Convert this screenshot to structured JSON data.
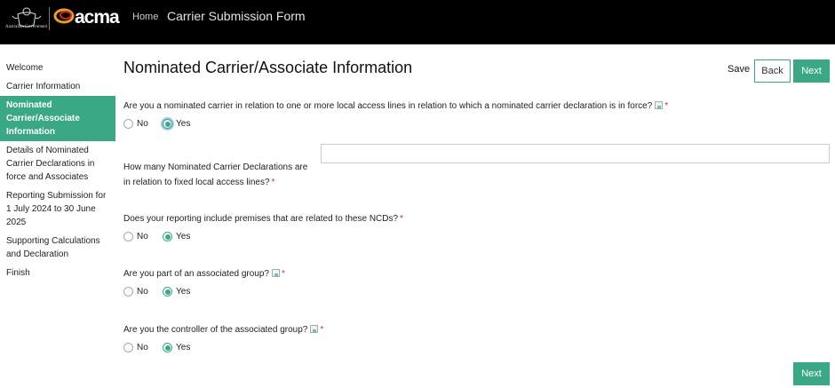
{
  "header": {
    "crest_caption": "Australian Government",
    "logo_text": "acma",
    "home_label": "Home",
    "app_title": "Carrier Submission Form"
  },
  "sidebar": {
    "items": [
      {
        "label": "Welcome"
      },
      {
        "label": "Carrier Information"
      },
      {
        "label": "Nominated Carrier/Associate Information",
        "active": true
      },
      {
        "label": "Details of Nominated Carrier Declarations in force and Associates"
      },
      {
        "label": "Reporting Submission for 1 July 2024 to 30 June 2025"
      },
      {
        "label": "Supporting Calculations and Declaration"
      },
      {
        "label": "Finish"
      }
    ]
  },
  "main": {
    "title": "Nominated Carrier/Associate Information",
    "save_label": "Save",
    "back_label": "Back",
    "next_label": "Next",
    "next_bottom_label": "Next",
    "required_marker": "*",
    "questions": [
      {
        "text": "Are you a nominated carrier in relation to one or more local access lines in relation to which a nominated carrier declaration is in force?",
        "has_help": true,
        "options": [
          "No",
          "Yes"
        ],
        "selected": "Yes"
      },
      {
        "text": "How many Nominated Carrier Declarations are in relation to fixed local access lines?",
        "has_help": false,
        "input_value": "",
        "input_placeholder": ""
      },
      {
        "text": "Does your reporting include premises that are related to these NCDs?",
        "has_help": false,
        "options": [
          "No",
          "Yes"
        ],
        "selected": "Yes"
      },
      {
        "text": "Are you part of an associated group?",
        "has_help": true,
        "options": [
          "No",
          "Yes"
        ],
        "selected": "Yes"
      },
      {
        "text": "Are you the controller of the associated group?",
        "has_help": true,
        "options": [
          "No",
          "Yes"
        ],
        "selected": "Yes"
      }
    ]
  },
  "colors": {
    "accent": "#3aa887",
    "header_bg": "#000000",
    "required": "#c0392b"
  }
}
